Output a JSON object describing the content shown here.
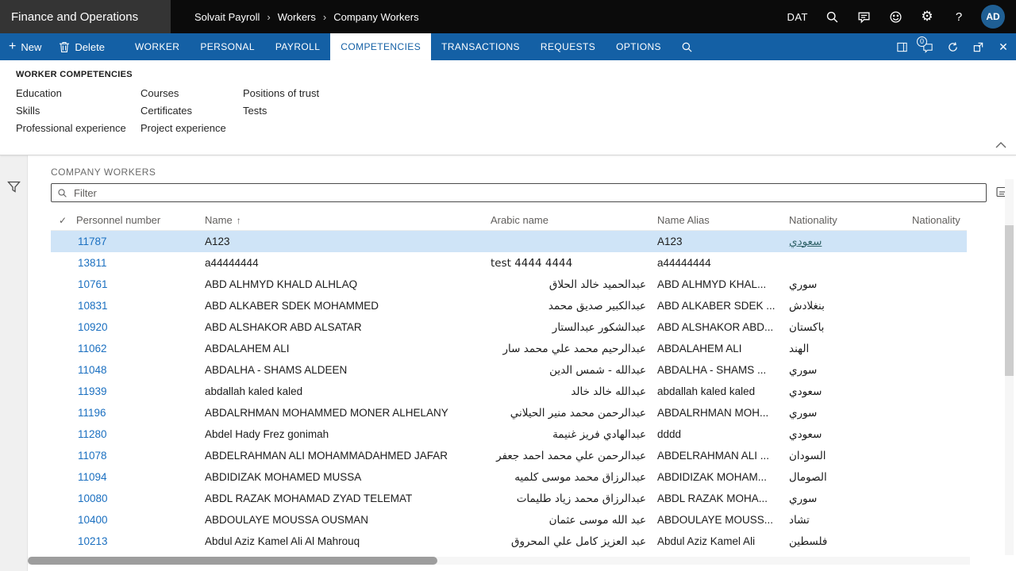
{
  "app": {
    "title": "Finance and Operations",
    "breadcrumb": [
      "Solvait Payroll",
      "Workers",
      "Company Workers"
    ],
    "environment": "DAT",
    "avatar_initials": "AD"
  },
  "command_bar": {
    "new_label": "New",
    "delete_label": "Delete",
    "tabs": [
      "WORKER",
      "PERSONAL",
      "PAYROLL",
      "COMPETENCIES",
      "TRANSACTIONS",
      "REQUESTS",
      "OPTIONS"
    ],
    "active_tab_index": 3,
    "badge_count": "0"
  },
  "ribbon": {
    "heading": "WORKER COMPETENCIES",
    "columns": [
      [
        "Education",
        "Skills",
        "Professional experience"
      ],
      [
        "Courses",
        "Certificates",
        "Project experience"
      ],
      [
        "Positions of trust",
        "Tests"
      ]
    ]
  },
  "grid": {
    "caption": "COMPANY WORKERS",
    "filter_placeholder": "Filter",
    "columns": [
      "Personnel number",
      "Name",
      "Arabic name",
      "Name Alias",
      "Nationality",
      "Nationality"
    ],
    "sorted_column": "Name",
    "rows": [
      {
        "selected": true,
        "personnel_number": "11787",
        "name": "A123",
        "arabic_name": "",
        "name_alias": "A123",
        "nationality": "سعودي"
      },
      {
        "selected": false,
        "personnel_number": "13811",
        "name": "a44444444",
        "arabic_name": "test 4444  4444",
        "name_alias": "a44444444",
        "nationality": ""
      },
      {
        "selected": false,
        "personnel_number": "10761",
        "name": "ABD ALHMYD KHALD ALHLAQ",
        "arabic_name": "عبدالحميد خالد الحلاق",
        "name_alias": "ABD ALHMYD KHAL...",
        "nationality": "سوري"
      },
      {
        "selected": false,
        "personnel_number": "10831",
        "name": "ABD ALKABER SDEK MOHAMMED",
        "arabic_name": "عبدالكبير صديق محمد",
        "name_alias": "ABD ALKABER SDEK ...",
        "nationality": "بنغلادش"
      },
      {
        "selected": false,
        "personnel_number": "10920",
        "name": "ABD ALSHAKOR ABD ALSATAR",
        "arabic_name": "عبدالشكور عبدالستار",
        "name_alias": "ABD ALSHAKOR ABD...",
        "nationality": "باكستان"
      },
      {
        "selected": false,
        "personnel_number": "11062",
        "name": "ABDALAHEM  ALI",
        "arabic_name": "عبدالرحيم محمد علي محمد سار",
        "name_alias": "ABDALAHEM ALI",
        "nationality": "الهند"
      },
      {
        "selected": false,
        "personnel_number": "11048",
        "name": "ABDALHA - SHAMS ALDEEN",
        "arabic_name": "عبدالله -  شمس الدين",
        "name_alias": "ABDALHA - SHAMS ...",
        "nationality": "سوري"
      },
      {
        "selected": false,
        "personnel_number": "11939",
        "name": "abdallah kaled kaled",
        "arabic_name": "عبدالله خالد  خالد",
        "name_alias": "abdallah kaled kaled",
        "nationality": "سعودي"
      },
      {
        "selected": false,
        "personnel_number": "11196",
        "name": "ABDALRHMAN MOHAMMED MONER ALHELANY",
        "arabic_name": "عبدالرحمن محمد منير الحيلاني",
        "name_alias": "ABDALRHMAN MOH...",
        "nationality": "سوري"
      },
      {
        "selected": false,
        "personnel_number": "11280",
        "name": "Abdel Hady Frez gonimah",
        "arabic_name": "عبدالهادي فريز غنيمة",
        "name_alias": "dddd",
        "nationality": "سعودي"
      },
      {
        "selected": false,
        "personnel_number": "11078",
        "name": "ABDELRAHMAN ALI MOHAMMADAHMED JAFAR",
        "arabic_name": "عبدالرحمن علي محمد احمد جعفر",
        "name_alias": "ABDELRAHMAN ALI ...",
        "nationality": "السودان"
      },
      {
        "selected": false,
        "personnel_number": "11094",
        "name": "ABDIDIZAK MOHAMED MUSSA",
        "arabic_name": "عبدالرزاق محمد موسى كلميه",
        "name_alias": "ABDIDIZAK MOHAM...",
        "nationality": "الصومال"
      },
      {
        "selected": false,
        "personnel_number": "10080",
        "name": "ABDL RAZAK MOHAMAD ZYAD TELEMAT",
        "arabic_name": "عبدالرزاق محمد زياد طليمات",
        "name_alias": "ABDL RAZAK MOHA...",
        "nationality": "سوري"
      },
      {
        "selected": false,
        "personnel_number": "10400",
        "name": "ABDOULAYE MOUSSA OUSMAN",
        "arabic_name": "عبد الله  موسى عثمان",
        "name_alias": "ABDOULAYE MOUSS...",
        "nationality": "تشاد"
      },
      {
        "selected": false,
        "personnel_number": "10213",
        "name": "Abdul Aziz Kamel Ali Al Mahrouq",
        "arabic_name": "عبد العزيز  كامل علي المحروق",
        "name_alias": "Abdul Aziz Kamel Ali",
        "nationality": "فلسطين"
      }
    ]
  },
  "glyphs": {
    "breadcrumb_separator": "›",
    "plus": "+",
    "sort_ascending": "↑",
    "header_check": "✓",
    "help": "?",
    "gear": "⚙",
    "close": "✕"
  },
  "colors": {
    "command_bar_blue": "#1460a5",
    "selected_row": "#cfe4f7",
    "link_blue": "#1a6fc0",
    "topbar_black": "#0b0b0b"
  }
}
